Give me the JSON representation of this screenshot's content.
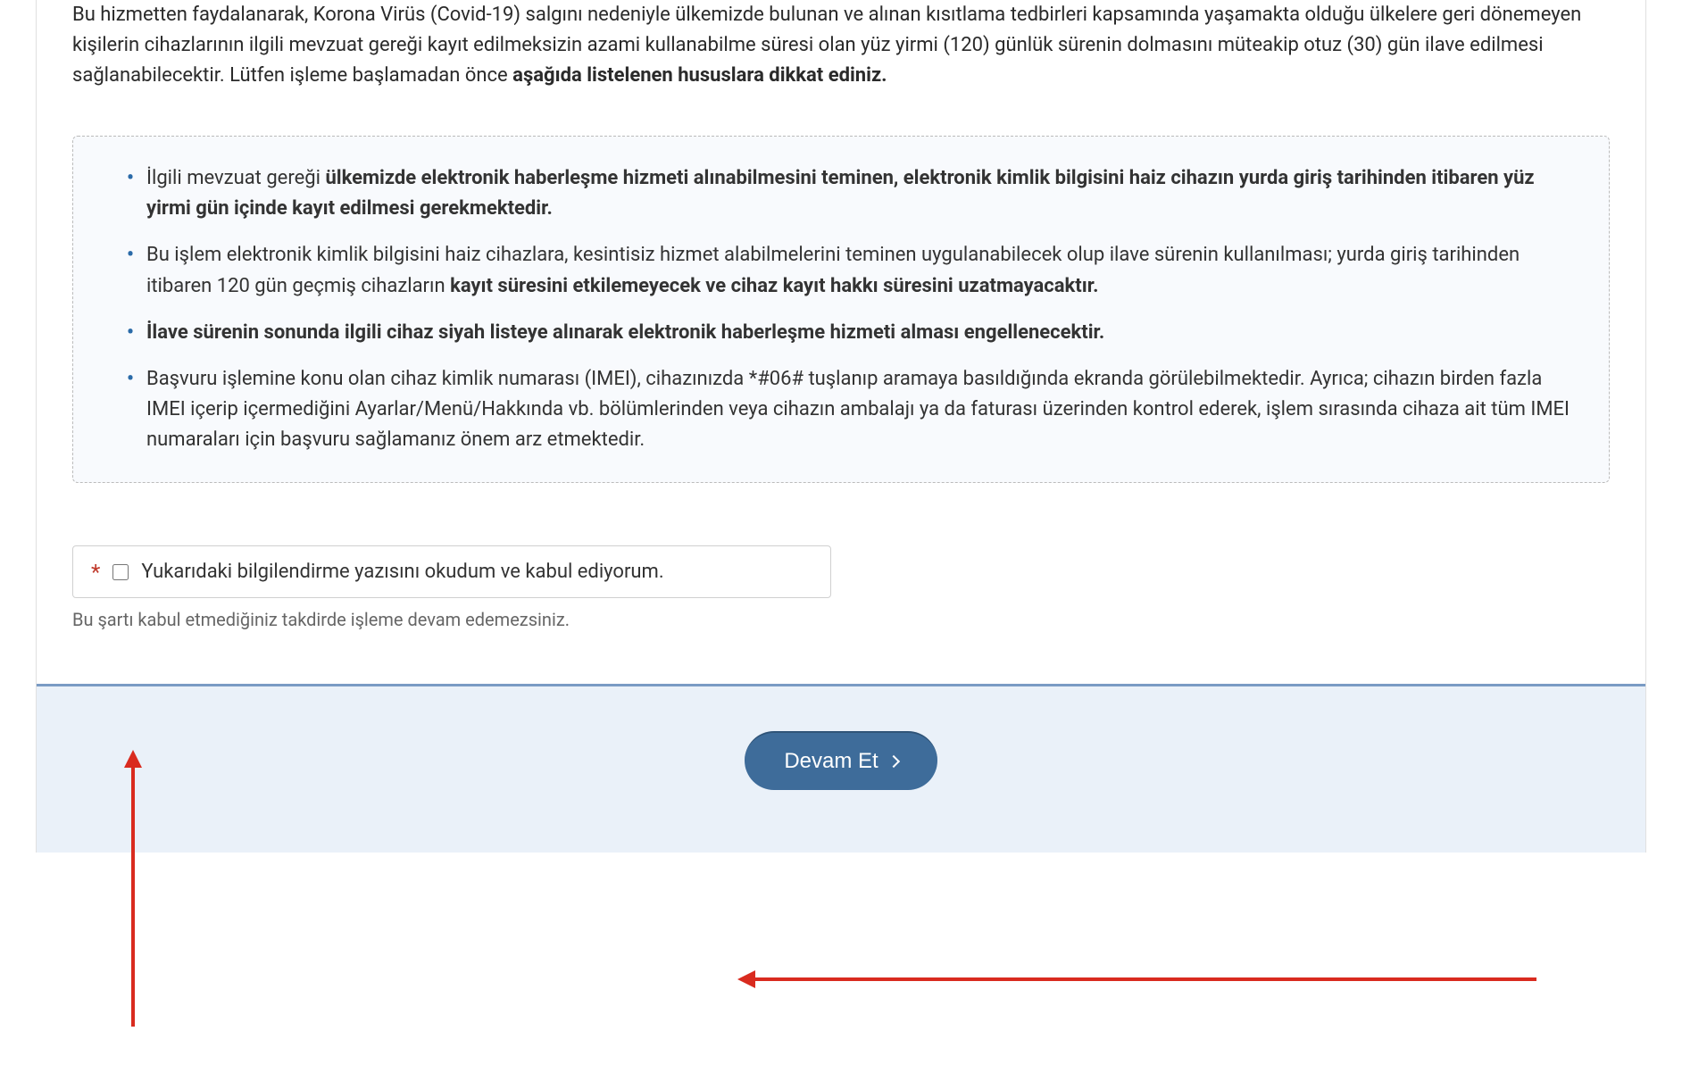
{
  "intro": {
    "text_part1": "Bu hizmetten faydalanarak, Korona Virüs (Covid-19) salgını nedeniyle ülkemizde bulunan ve alınan kısıtlama tedbirleri kapsamında yaşamakta olduğu ülkelere geri dönemeyen kişilerin cihazlarının ilgili mevzuat gereği kayıt edilmeksizin azami kullanabilme süresi olan yüz yirmi (120) günlük sürenin dolmasını müteakip otuz (30) gün ilave edilmesi sağlanabilecektir. Lütfen işleme başlamadan önce ",
    "text_bold": "aşağıda listelenen hususlara dikkat ediniz."
  },
  "bullets": {
    "b1_pre": "İlgili mevzuat gereği ",
    "b1_bold": "ülkemizde elektronik haberleşme hizmeti alınabilmesini teminen, elektronik kimlik bilgisini haiz cihazın yurda giriş tarihinden itibaren yüz yirmi gün içinde kayıt edilmesi gerekmektedir.",
    "b2_pre": "Bu işlem elektronik kimlik bilgisini haiz cihazlara, kesintisiz hizmet alabilmelerini teminen uygulanabilecek olup ilave sürenin kullanılması; yurda giriş tarihinden itibaren 120 gün geçmiş cihazların ",
    "b2_bold": "kayıt süresini etkilemeyecek ve cihaz kayıt hakkı süresini uzatmayacaktır.",
    "b3_bold": "İlave sürenin sonunda ilgili cihaz siyah listeye alınarak elektronik haberleşme hizmeti alması engellenecektir.",
    "b4": "Başvuru işlemine konu olan cihaz kimlik numarası (IMEI), cihazınızda *#06# tuşlanıp aramaya basıldığında ekranda görülebilmektedir. Ayrıca; cihazın birden fazla IMEI içerip içermediğini Ayarlar/Menü/Hakkında vb. bölümlerinden veya cihazın ambalajı ya da faturası üzerinden kontrol ederek, işlem sırasında cihaza ait tüm IMEI numaraları için başvuru sağlamanız önem arz etmektedir."
  },
  "consent": {
    "star": "*",
    "label": "Yukarıdaki bilgilendirme yazısını okudum ve kabul ediyorum.",
    "help": "Bu şartı kabul etmediğiniz takdirde işleme devam edemezsiniz."
  },
  "button": {
    "continue": "Devam Et"
  }
}
